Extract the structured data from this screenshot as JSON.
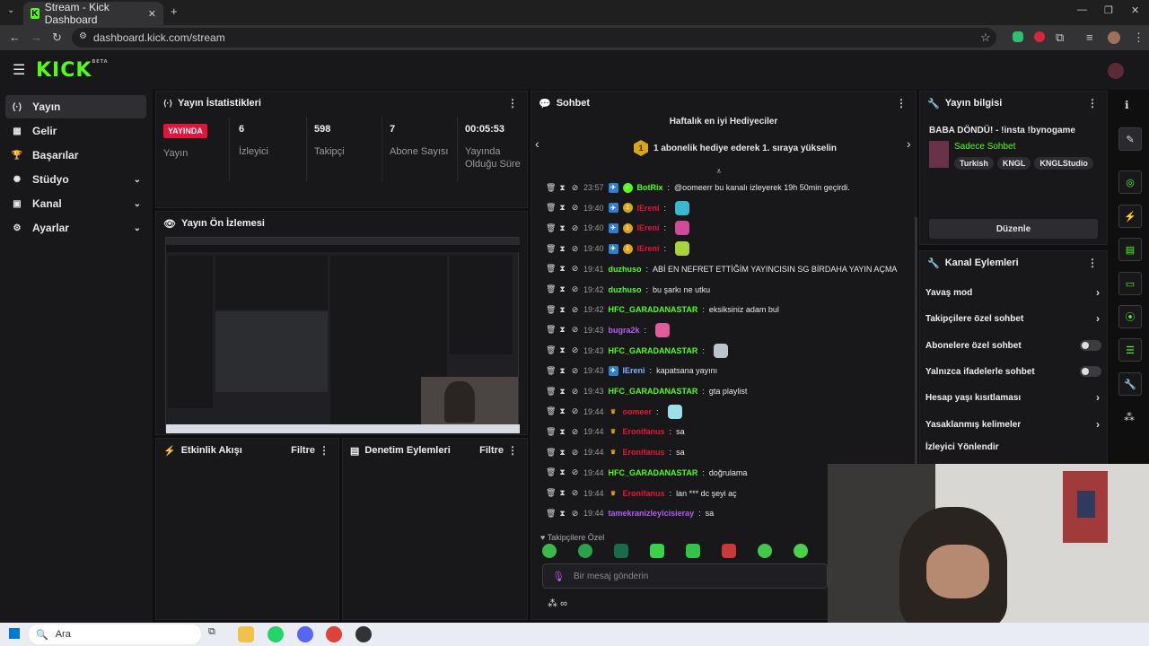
{
  "browser": {
    "tab_title": "Stream - Kick Dashboard",
    "favicon": "K",
    "url": "dashboard.kick.com/stream"
  },
  "header": {
    "logo": "KICK",
    "logo_sup": "BETA"
  },
  "sidebar": {
    "items": [
      {
        "label": "Yayın",
        "icon": "(·)"
      },
      {
        "label": "Gelir",
        "icon": "▦"
      },
      {
        "label": "Başarılar",
        "icon": "🏆"
      },
      {
        "label": "Stüdyo",
        "icon": "✺"
      },
      {
        "label": "Kanal",
        "icon": "▣"
      },
      {
        "label": "Ayarlar",
        "icon": "⚙"
      }
    ]
  },
  "stats_panel": {
    "title": "Yayın İstatistikleri",
    "live_badge": "YAYINDA",
    "live_label": "Yayın",
    "viewers_value": "6",
    "viewers_label": "İzleyici",
    "followers_value": "598",
    "followers_label": "Takipçi",
    "subs_value": "7",
    "subs_label": "Abone Sayısı",
    "uptime_value": "00:05:53",
    "uptime_label": "Yayında Olduğu Süre"
  },
  "preview_panel": {
    "title": "Yayın Ön İzlemesi"
  },
  "activity_panel": {
    "title": "Etkinlik Akışı",
    "filter": "Filtre"
  },
  "mod_panel": {
    "title": "Denetim Eylemleri",
    "filter": "Filtre"
  },
  "chat": {
    "title": "Sohbet",
    "gifters_title": "Haftalık en iyi Hediyeciler",
    "gifters_rank": "1",
    "gifters_text": "1 abonelik hediye ederek 1. sıraya yükselin",
    "messages": [
      {
        "time": "23:57",
        "user": "BotRix",
        "msg": "@oomeerr bu kanalı izleyerek 19h 50min geçirdi."
      },
      {
        "time": "19:40",
        "user": "IEreni",
        "msg": ""
      },
      {
        "time": "19:40",
        "user": "IEreni",
        "msg": ""
      },
      {
        "time": "19:40",
        "user": "IEreni",
        "msg": ""
      },
      {
        "time": "19:41",
        "user": "duzhuso",
        "msg": "ABİ EN NEFRET ETTİĞİM YAYINCISIN SG BİRDAHA YAYIN AÇMA"
      },
      {
        "time": "19:42",
        "user": "duzhuso",
        "msg": "bu şarkı ne utku"
      },
      {
        "time": "19:42",
        "user": "HFC_GARADANASTAR",
        "msg": "eksiksiniz adam bul"
      },
      {
        "time": "19:43",
        "user": "bugra2k",
        "msg": ""
      },
      {
        "time": "19:43",
        "user": "HFC_GARADANASTAR",
        "msg": ""
      },
      {
        "time": "19:43",
        "user": "IEreni",
        "msg": "kapatsana yayını"
      },
      {
        "time": "19:43",
        "user": "HFC_GARADANASTAR",
        "msg": "gta playlist"
      },
      {
        "time": "19:44",
        "user": "oomeer",
        "msg": ""
      },
      {
        "time": "19:44",
        "user": "Eronifanus",
        "msg": "sa"
      },
      {
        "time": "19:44",
        "user": "Eronifanus",
        "msg": "sa"
      },
      {
        "time": "19:44",
        "user": "HFC_GARADANASTAR",
        "msg": "doğrulama"
      },
      {
        "time": "19:44",
        "user": "Eronifanus",
        "msg": "lan *** dc şeyi aç"
      },
      {
        "time": "19:44",
        "user": "tamekranizleyicisieray",
        "msg": "sa"
      }
    ],
    "followers_only": "Takipçilere Özel",
    "input_placeholder": "Bir mesaj gönderin",
    "bottom_icon": "∞"
  },
  "stream_info": {
    "title": "Yayın bilgisi",
    "stream_title": "BABA DÖNDÜ! - !insta !bynogame",
    "category": "Sadece Sohbet",
    "tags": [
      "Turkish",
      "KNGL",
      "KNGLStudio"
    ],
    "edit_button": "Düzenle"
  },
  "channel_actions": {
    "title": "Kanal Eylemleri",
    "items": [
      {
        "label": "Yavaş mod",
        "kind": "chevron"
      },
      {
        "label": "Takipçilere özel sohbet",
        "kind": "chevron"
      },
      {
        "label": "Abonelere özel sohbet",
        "kind": "toggle"
      },
      {
        "label": "Yalnızca ifadelerle sohbet",
        "kind": "toggle"
      },
      {
        "label": "Hesap yaşı kısıtlaması",
        "kind": "chevron"
      },
      {
        "label": "Yasaklanmış kelimeler",
        "kind": "chevron"
      },
      {
        "label": "İzleyici Yönlendir",
        "kind": "none"
      }
    ]
  },
  "taskbar": {
    "search_placeholder": "Ara"
  },
  "colors": {
    "brand": "#53fc18",
    "live": "#e3143b",
    "user_green": "#53fc18",
    "user_red": "#e3143b",
    "user_purple": "#b25cf0",
    "user_blue": "#7fb2ff"
  }
}
